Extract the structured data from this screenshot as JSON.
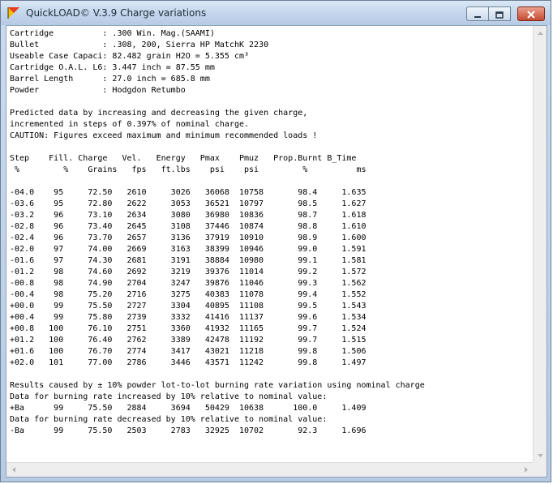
{
  "window": {
    "title": "QuickLOAD© V.3.9 Charge variations"
  },
  "report": {
    "header": [
      {
        "label": "Cartridge",
        "value": ".300 Win. Mag.(SAAMI)"
      },
      {
        "label": "Bullet",
        "value": ".308, 200, Sierra HP MatchK 2230"
      },
      {
        "label": "Useable Case Capaci",
        "value": "82.482 grain H2O = 5.355 cm³"
      },
      {
        "label": "Cartridge O.A.L. L6",
        "value": "3.447 inch = 87.55 mm"
      },
      {
        "label": "Barrel Length",
        "value": "27.0 inch = 685.8 mm"
      },
      {
        "label": "Powder",
        "value": "Hodgdon Retumbo"
      }
    ],
    "intro": [
      "Predicted data by increasing and decreasing the given charge,",
      "incremented in steps of 0.397% of nominal charge.",
      "CAUTION: Figures exceed maximum and minimum recommended loads !"
    ],
    "columns": [
      {
        "name": "Step",
        "unit": "%"
      },
      {
        "name": "Fill.",
        "unit": "%"
      },
      {
        "name": "Charge",
        "unit": "Grains"
      },
      {
        "name": "Vel.",
        "unit": "fps"
      },
      {
        "name": "Energy",
        "unit": "ft.lbs"
      },
      {
        "name": "Pmax",
        "unit": "psi"
      },
      {
        "name": "Pmuz",
        "unit": "psi"
      },
      {
        "name": "Prop.Burnt",
        "unit": "%"
      },
      {
        "name": "B_Time",
        "unit": "ms"
      }
    ],
    "rows": [
      [
        "-04.0",
        "95",
        "72.50",
        "2610",
        "3026",
        "36068",
        "10758",
        "98.4",
        "1.635"
      ],
      [
        "-03.6",
        "95",
        "72.80",
        "2622",
        "3053",
        "36521",
        "10797",
        "98.5",
        "1.627"
      ],
      [
        "-03.2",
        "96",
        "73.10",
        "2634",
        "3080",
        "36980",
        "10836",
        "98.7",
        "1.618"
      ],
      [
        "-02.8",
        "96",
        "73.40",
        "2645",
        "3108",
        "37446",
        "10874",
        "98.8",
        "1.610"
      ],
      [
        "-02.4",
        "96",
        "73.70",
        "2657",
        "3136",
        "37919",
        "10910",
        "98.9",
        "1.600"
      ],
      [
        "-02.0",
        "97",
        "74.00",
        "2669",
        "3163",
        "38399",
        "10946",
        "99.0",
        "1.591"
      ],
      [
        "-01.6",
        "97",
        "74.30",
        "2681",
        "3191",
        "38884",
        "10980",
        "99.1",
        "1.581"
      ],
      [
        "-01.2",
        "98",
        "74.60",
        "2692",
        "3219",
        "39376",
        "11014",
        "99.2",
        "1.572"
      ],
      [
        "-00.8",
        "98",
        "74.90",
        "2704",
        "3247",
        "39876",
        "11046",
        "99.3",
        "1.562"
      ],
      [
        "-00.4",
        "98",
        "75.20",
        "2716",
        "3275",
        "40383",
        "11078",
        "99.4",
        "1.552"
      ],
      [
        "+00.0",
        "99",
        "75.50",
        "2727",
        "3304",
        "40895",
        "11108",
        "99.5",
        "1.543"
      ],
      [
        "+00.4",
        "99",
        "75.80",
        "2739",
        "3332",
        "41416",
        "11137",
        "99.6",
        "1.534"
      ],
      [
        "+00.8",
        "100",
        "76.10",
        "2751",
        "3360",
        "41932",
        "11165",
        "99.7",
        "1.524"
      ],
      [
        "+01.2",
        "100",
        "76.40",
        "2762",
        "3389",
        "42478",
        "11192",
        "99.7",
        "1.515"
      ],
      [
        "+01.6",
        "100",
        "76.70",
        "2774",
        "3417",
        "43021",
        "11218",
        "99.8",
        "1.506"
      ],
      [
        "+02.0",
        "101",
        "77.00",
        "2786",
        "3446",
        "43571",
        "11242",
        "99.8",
        "1.497"
      ]
    ],
    "variation_title": "Results caused by ± 10% powder lot-to-lot burning rate variation using nominal charge",
    "increase_label": "Data for burning rate increased by 10% relative to nominal value:",
    "increase_row": [
      "+Ba",
      "99",
      "75.50",
      "2884",
      "3694",
      "50429",
      "10638",
      "100.0",
      "1.409"
    ],
    "decrease_label": "Data for burning rate decreased by 10% relative to nominal value:",
    "decrease_row": [
      "-Ba",
      "99",
      "75.50",
      "2503",
      "2783",
      "32925",
      "10702",
      "92.3",
      "1.696"
    ]
  },
  "icons": {
    "app": "quickload-pennant-icon",
    "minimize": "minimize-icon",
    "maximize": "maximize-icon",
    "close": "close-icon"
  },
  "colors": {
    "titlebar": "#c4d6ec",
    "close_button": "#c74a30",
    "text": "#000000",
    "background": "#ffffff"
  }
}
